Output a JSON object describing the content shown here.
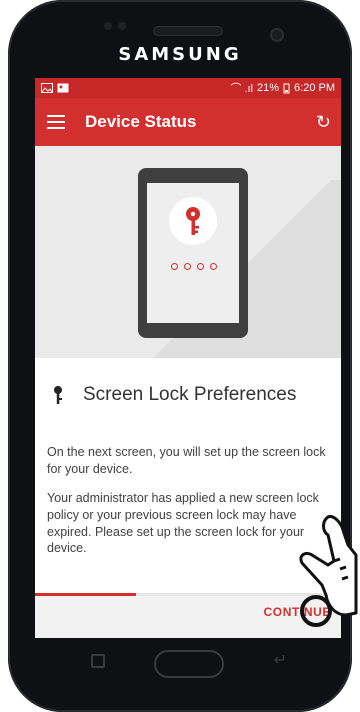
{
  "device": {
    "brand": "SAMSUNG"
  },
  "status_bar": {
    "left_icons": [
      "image-icon",
      "photo-icon"
    ],
    "signal": "⌒ .ıl",
    "battery_percent": "21%",
    "time": "6:20 PM"
  },
  "app_bar": {
    "title": "Device Status"
  },
  "section": {
    "title": "Screen Lock Preferences"
  },
  "body": {
    "paragraph1": "On the next screen, you will set up the screen lock for your device.",
    "paragraph2": "Your administrator has applied a new screen lock policy or your previous screen lock may have expired. Please set up the screen lock for your device."
  },
  "footer": {
    "continue_label": "CONTINUE",
    "progress": 0.33
  },
  "colors": {
    "accent": "#d32f2f",
    "status": "#c62828"
  }
}
